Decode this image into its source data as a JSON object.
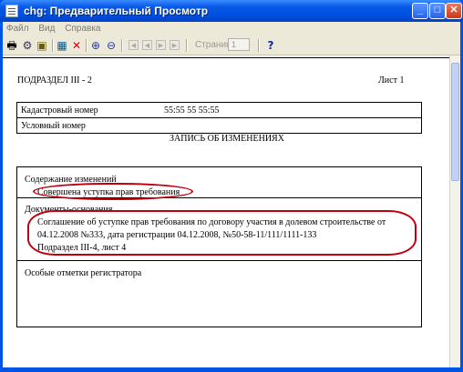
{
  "window": {
    "title": "chg: Предварительный Просмотр"
  },
  "menu": {
    "items": [
      "Файл",
      "Вид",
      "Справка"
    ]
  },
  "toolbar": {
    "page_label": "Страница",
    "page_value": "1",
    "help_label": "?"
  },
  "document": {
    "subsection": "ПОДРАЗДЕЛ  III - 2",
    "sheet": "Лист 1",
    "cadastral_label": "Кадастровый номер",
    "cadastral_value": "55:55 55 55:55",
    "conditional_label": "Условный номер",
    "record_title": "ЗАПИСЬ ОБ ИЗМЕНЕНИЯХ",
    "changes_label": "Содержание изменений",
    "changes_value": "Совершена уступка прав требования",
    "basis_label": "Документы-основания",
    "basis_line1": "Соглашение об уступке прав требования по договору участия в долевом строительстве от",
    "basis_line2": "04.12.2008 №333, дата регистрации 04.12.2008, №50-58-11/111/1111-133",
    "basis_line3": "Подраздел III-4, лист 4",
    "registrar_label": "Особые отметки регистратора"
  }
}
